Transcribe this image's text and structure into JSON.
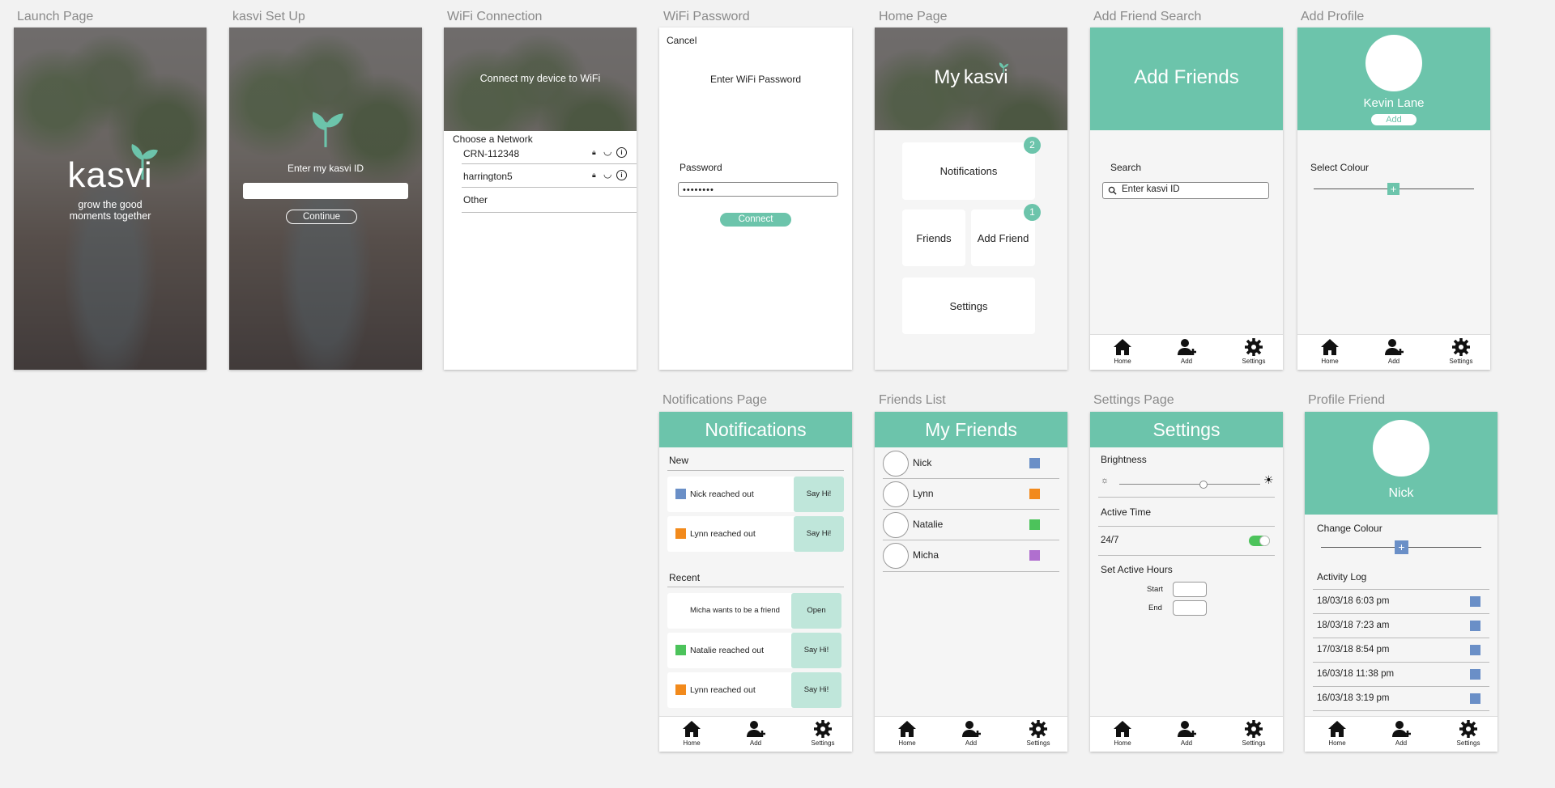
{
  "labels": {
    "launch": "Launch Page",
    "setup": "kasvi Set Up",
    "wifi": "WiFi Connection",
    "wifipw": "WiFi Password",
    "home": "Home Page",
    "addsearch": "Add Friend Search",
    "addprofile": "Add Profile",
    "notifs": "Notifications Page",
    "friends": "Friends List",
    "settings": "Settings Page",
    "profile": "Profile Friend"
  },
  "launch": {
    "logo": "kasvi",
    "tagline_1": "grow the good",
    "tagline_2": "moments together"
  },
  "setup": {
    "prompt": "Enter my kasvi ID",
    "input_value": "",
    "button": "Continue"
  },
  "wifi": {
    "header": "Connect my device to WiFi",
    "section": "Choose a Network",
    "networks": [
      {
        "name": "CRN-112348"
      },
      {
        "name": "harrington5"
      }
    ],
    "other": "Other"
  },
  "wifipw": {
    "cancel": "Cancel",
    "title": "Enter WiFi Password",
    "password_label": "Password",
    "password_value": "••••••••",
    "button": "Connect"
  },
  "home": {
    "title_my": "My",
    "title_brand": "kasvi",
    "notifications": "Notifications",
    "notifications_badge": "2",
    "friends": "Friends",
    "add_friend": "Add Friend",
    "add_friend_badge": "1",
    "settings": "Settings"
  },
  "addsearch": {
    "title": "Add Friends",
    "search_label": "Search",
    "search_placeholder": "Enter kasvi ID"
  },
  "addprofile": {
    "name": "Kevin Lane",
    "add_button": "Add",
    "select_colour": "Select Colour",
    "slider_symbol": "+"
  },
  "nav": {
    "home": "Home",
    "add": "Add",
    "settings": "Settings"
  },
  "notifs": {
    "title": "Notifications",
    "new_label": "New",
    "new_items": [
      {
        "text": "Nick reached out",
        "action": "Say Hi!",
        "color": "#6a8fc7"
      },
      {
        "text": "Lynn reached out",
        "action": "Say Hi!",
        "color": "#f28a1c"
      }
    ],
    "recent_label": "Recent",
    "recent_items": [
      {
        "text": "Micha wants to be a friend",
        "action": "Open",
        "color": ""
      },
      {
        "text": "Natalie reached out",
        "action": "Say Hi!",
        "color": "#4cc35b"
      },
      {
        "text": "Lynn reached out",
        "action": "Say Hi!",
        "color": "#f28a1c"
      }
    ]
  },
  "friends": {
    "title": "My Friends",
    "list": [
      {
        "name": "Nick",
        "color": "#6a8fc7"
      },
      {
        "name": "Lynn",
        "color": "#f28a1c"
      },
      {
        "name": "Natalie",
        "color": "#4cc35b"
      },
      {
        "name": "Micha",
        "color": "#b06fcf"
      }
    ]
  },
  "settings": {
    "title": "Settings",
    "brightness": "Brightness",
    "brightness_level": 0.6,
    "active_time": "Active Time",
    "always": "24/7",
    "always_on": true,
    "set_hours": "Set Active Hours",
    "start": "Start",
    "end": "End"
  },
  "profile": {
    "name": "Nick",
    "change_colour": "Change Colour",
    "slider_symbol": "+",
    "activity_log": "Activity Log",
    "log": [
      {
        "text": "18/03/18 6:03 pm"
      },
      {
        "text": "18/03/18 7:23 am"
      },
      {
        "text": "17/03/18 8:54 pm"
      },
      {
        "text": "16/03/18 11:38 pm"
      },
      {
        "text": "16/03/18 3:19 pm"
      }
    ],
    "log_color": "#6a8fc7"
  },
  "colors": {
    "accent": "#6cc4ab",
    "accent_light": "#bfe6da",
    "toggle": "#4cc35b"
  }
}
